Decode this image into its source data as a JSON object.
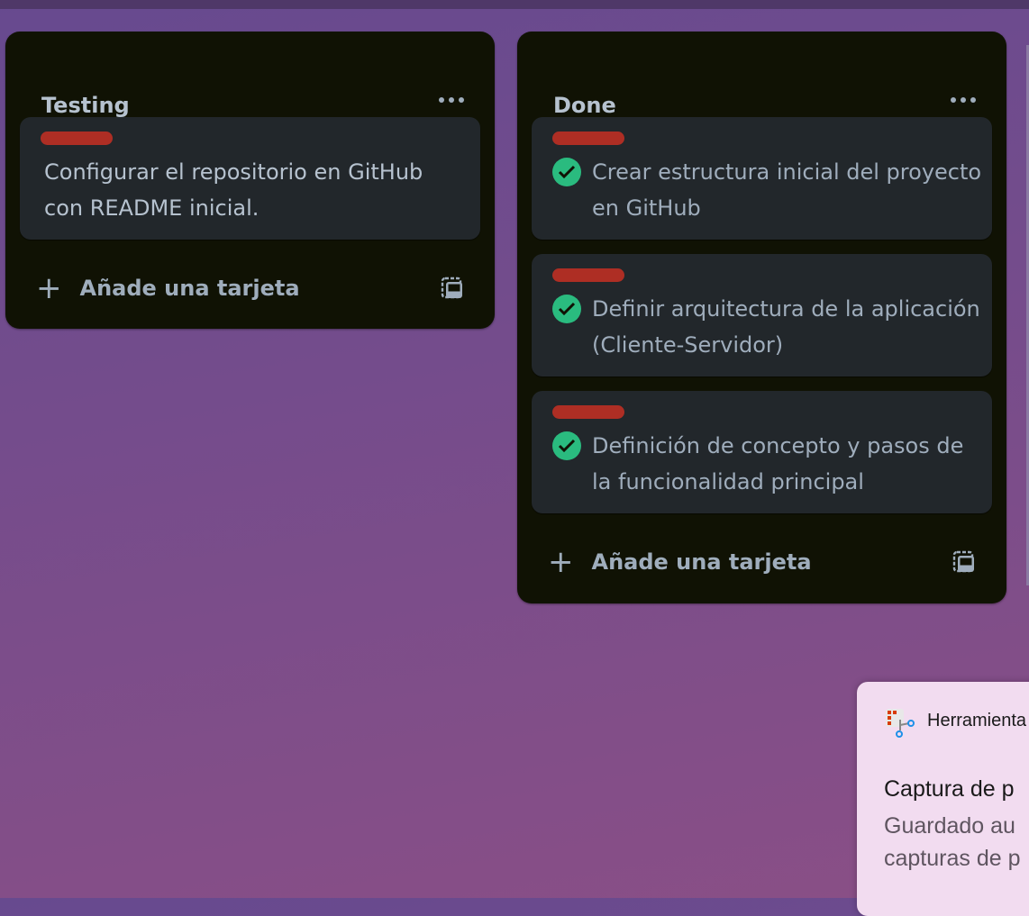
{
  "lists": [
    {
      "title": "Testing",
      "cards": [
        {
          "label_color": "#ae2e24",
          "text": "Configurar el repositorio en GitHub con README inicial.",
          "done": false
        }
      ],
      "add_card": "Añade una tarjeta"
    },
    {
      "title": "Done",
      "cards": [
        {
          "label_color": "#ae2e24",
          "text": "Crear estructura inicial del proyecto en GitHub",
          "done": true
        },
        {
          "label_color": "#ae2e24",
          "text": "Definir arquitectura de la aplicación (Cliente-Servidor)",
          "done": true
        },
        {
          "label_color": "#ae2e24",
          "text": "Definición de concepto y pasos de la funcionalidad principal",
          "done": true
        }
      ],
      "add_card": "Añade una tarjeta"
    }
  ],
  "toast": {
    "app": "Herramienta",
    "title": "Captura de p",
    "body_line1": "Guardado au",
    "body_line2": "capturas de p",
    "icon": "snipping-tool-icon"
  },
  "colors": {
    "list_bg": "#101204",
    "card_bg": "#22272b",
    "label_red": "#ae2e24",
    "check_green": "#2abb7f"
  }
}
